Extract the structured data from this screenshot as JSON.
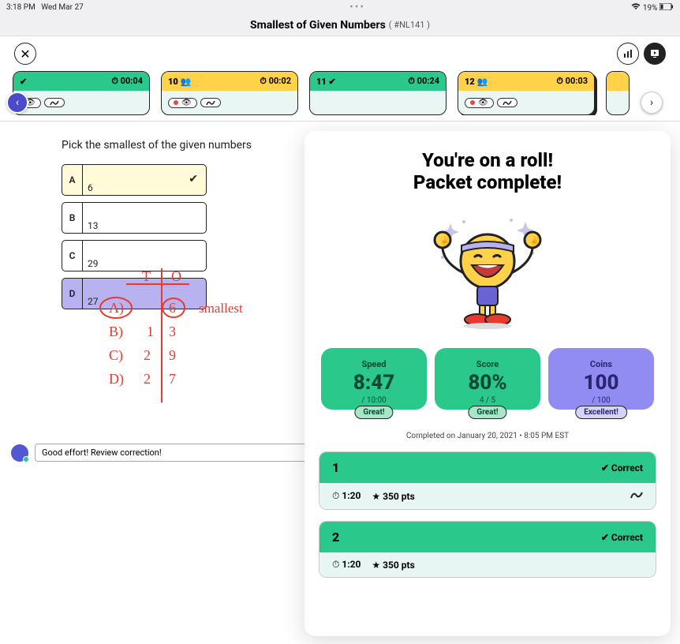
{
  "status": {
    "time": "3:18 PM",
    "day": "Wed Mar 27",
    "battery": "19%"
  },
  "page": {
    "title": "Smallest of Given Numbers",
    "code": "( #NL141 )"
  },
  "cards": [
    {
      "num": "",
      "time": "00:04",
      "head": "green",
      "check": true
    },
    {
      "num": "10",
      "time": "00:02",
      "head": "yellow",
      "people": true
    },
    {
      "num": "11",
      "time": "00:24",
      "head": "green",
      "check": true
    },
    {
      "num": "12",
      "time": "00:03",
      "head": "yellow",
      "people": true,
      "selected": true
    }
  ],
  "question": {
    "prompt": "Pick the smallest of the given numbers"
  },
  "answers": [
    {
      "letter": "A",
      "value": "6",
      "selected": true
    },
    {
      "letter": "B",
      "value": "13"
    },
    {
      "letter": "C",
      "value": "29"
    },
    {
      "letter": "D",
      "value": "27",
      "purple": true
    }
  ],
  "handnote": "smallest",
  "feedback": {
    "text": "Good effort! Review correction!"
  },
  "panel": {
    "headline1": "You're on a roll!",
    "headline2": "Packet complete!",
    "stats": [
      {
        "label": "Speed",
        "big": "8:47",
        "sub": "/ 10:00",
        "badge": "Great!",
        "color": "green"
      },
      {
        "label": "Score",
        "big": "80%",
        "sub": "4 / 5",
        "badge": "Great!",
        "color": "green"
      },
      {
        "label": "Coins",
        "big": "100",
        "sub": "/ 100",
        "badge": "Excellent!",
        "color": "purple"
      }
    ],
    "completed": "Completed on January 20, 2021 • 8:05 PM EST",
    "results": [
      {
        "num": "1",
        "status": "Correct",
        "time": "1:20",
        "pts": "350 pts"
      },
      {
        "num": "2",
        "status": "Correct",
        "time": "1:20",
        "pts": "350 pts"
      }
    ]
  }
}
